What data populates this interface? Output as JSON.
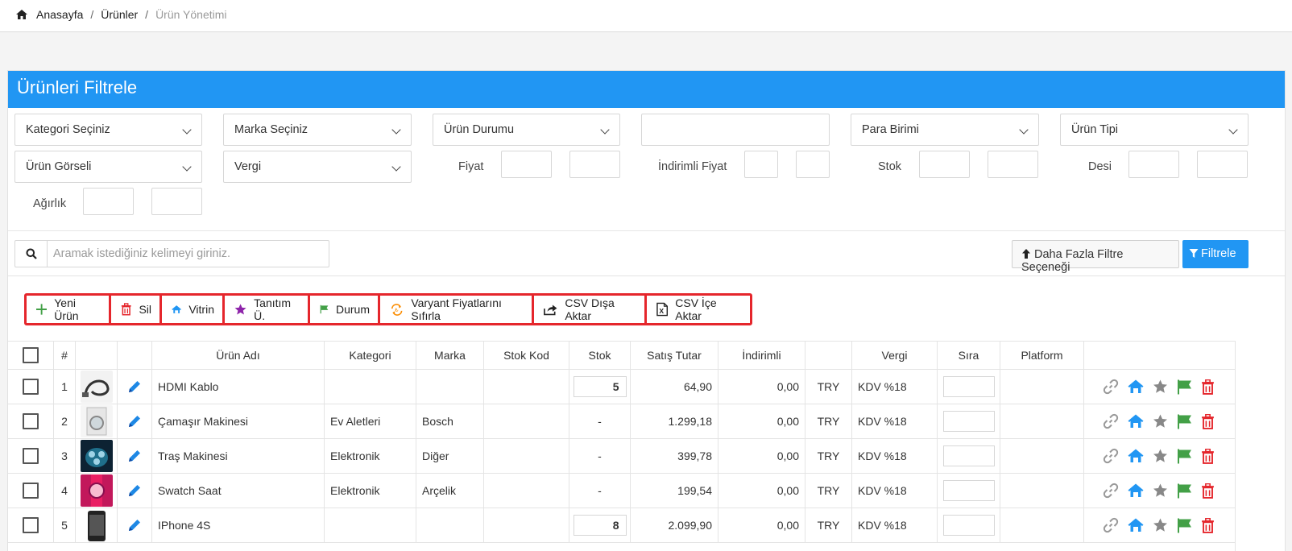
{
  "breadcrumb": {
    "home": "Anasayfa",
    "products": "Ürünler",
    "current": "Ürün Yönetimi",
    "separator": "/"
  },
  "filter_panel": {
    "title": "Ürünleri Filtrele",
    "selects": {
      "category": "Kategori Seçiniz",
      "brand": "Marka Seçiniz",
      "status": "Ürün Durumu",
      "currency": "Para Birimi",
      "product_type": "Ürün Tipi",
      "image": "Ürün Görseli",
      "tax": "Vergi"
    },
    "labels": {
      "price": "Fiyat",
      "discount_price": "İndirimli Fiyat",
      "stock": "Stok",
      "desi": "Desi",
      "weight": "Ağırlık"
    },
    "search_placeholder": "Aramak istediğiniz kelimeyi giriniz.",
    "more_filters": "Daha Fazla Filtre Seçeneği",
    "filter_button": "Filtrele"
  },
  "toolbar": {
    "new_product": "Yeni Ürün",
    "delete": "Sil",
    "showcase": "Vitrin",
    "promo": "Tanıtım Ü.",
    "status": "Durum",
    "reset_variants": "Varyant Fiyatlarını Sıfırla",
    "csv_export": "CSV Dışa Aktar",
    "csv_import": "CSV İçe Aktar"
  },
  "table": {
    "headers": {
      "num": "#",
      "name": "Ürün Adı",
      "category": "Kategori",
      "brand": "Marka",
      "stock_code": "Stok Kod",
      "stock": "Stok",
      "sale_price": "Satış Tutar",
      "discounted": "İndirimli",
      "tax": "Vergi",
      "order": "Sıra",
      "platform": "Platform"
    },
    "rows": [
      {
        "num": "1",
        "name": "HDMI Kablo",
        "category": "",
        "brand": "",
        "stock": "5",
        "stock_editable": true,
        "price": "64,90",
        "discounted": "0,00",
        "currency": "TRY",
        "tax": "KDV %18",
        "thumb": "cable"
      },
      {
        "num": "2",
        "name": "Çamaşır Makinesi",
        "category": "Ev Aletleri",
        "brand": "Bosch",
        "stock": "-",
        "stock_editable": false,
        "price": "1.299,18",
        "discounted": "0,00",
        "currency": "TRY",
        "tax": "KDV %18",
        "thumb": "washer"
      },
      {
        "num": "3",
        "name": "Traş Makinesi",
        "category": "Elektronik",
        "brand": "Diğer",
        "stock": "-",
        "stock_editable": false,
        "price": "399,78",
        "discounted": "0,00",
        "currency": "TRY",
        "tax": "KDV %18",
        "thumb": "shaver"
      },
      {
        "num": "4",
        "name": "Swatch Saat",
        "category": "Elektronik",
        "brand": "Arçelik",
        "stock": "-",
        "stock_editable": false,
        "price": "199,54",
        "discounted": "0,00",
        "currency": "TRY",
        "tax": "KDV %18",
        "thumb": "watch"
      },
      {
        "num": "5",
        "name": "IPhone 4S",
        "category": "",
        "brand": "",
        "stock": "8",
        "stock_editable": true,
        "price": "2.099,90",
        "discounted": "0,00",
        "currency": "TRY",
        "tax": "KDV %18",
        "thumb": "phone"
      }
    ]
  },
  "colors": {
    "primary": "#2196f3",
    "danger": "#e5262c",
    "green": "#43a047",
    "purple": "#8e24aa",
    "orange": "#fb8c00"
  },
  "icons": [
    "home-icon",
    "chevron-down-icon",
    "search-icon",
    "arrow-up-icon",
    "filter-icon",
    "plus-icon",
    "trash-icon",
    "house-icon",
    "star-icon",
    "flag-icon",
    "refresh-icon",
    "export-icon",
    "excel-icon",
    "pencil-icon",
    "link-icon"
  ]
}
